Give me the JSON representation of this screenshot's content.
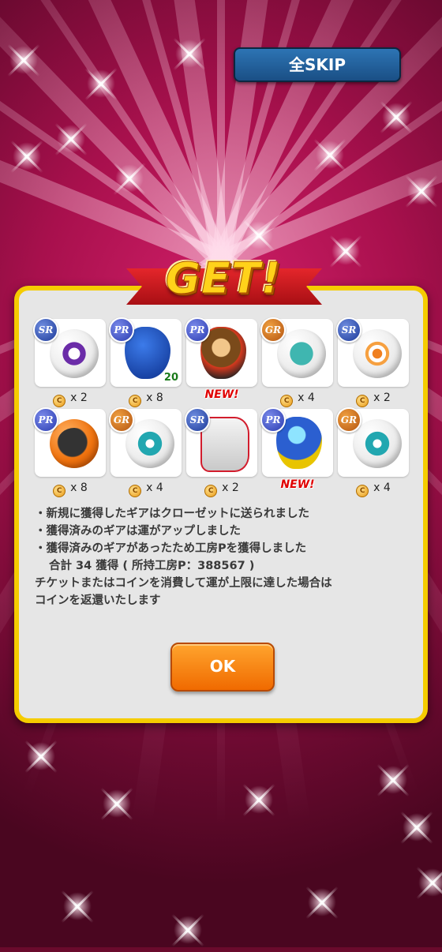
{
  "header": {
    "skip_label": "全SKIP"
  },
  "title": {
    "text": "GET!"
  },
  "rewards": [
    {
      "rarity": "SR",
      "kind": "ball",
      "icon": "purple-swirl-ball-icon",
      "count": "x 2",
      "is_new": false
    },
    {
      "rarity": "PR",
      "kind": "club",
      "icon": "blue-driver-club-icon",
      "count": "x 8",
      "is_new": false,
      "level": "20"
    },
    {
      "rarity": "PR",
      "kind": "club",
      "icon": "character-driver-club-icon",
      "count": "",
      "is_new": true
    },
    {
      "rarity": "GR",
      "kind": "ball",
      "icon": "rooster-weathervane-ball-icon",
      "count": "x 4",
      "is_new": false
    },
    {
      "rarity": "SR",
      "kind": "ball",
      "icon": "orange-target-ball-icon",
      "count": "x 2",
      "is_new": false
    },
    {
      "rarity": "PR",
      "kind": "ball",
      "icon": "black-helmet-orange-ball-icon",
      "count": "x 8",
      "is_new": false
    },
    {
      "rarity": "GR",
      "kind": "ball",
      "icon": "teal-golf-emblem-ball-icon",
      "count": "x 4",
      "is_new": false
    },
    {
      "rarity": "SR",
      "kind": "club",
      "icon": "red-wing-iron-club-icon",
      "count": "x 2",
      "is_new": false
    },
    {
      "rarity": "PR",
      "kind": "club",
      "icon": "diamond-driver-club-icon",
      "count": "",
      "is_new": true
    },
    {
      "rarity": "GR",
      "kind": "ball",
      "icon": "teal-golf-emblem-ball-icon",
      "count": "x 4",
      "is_new": false
    }
  ],
  "new_label": "NEW!",
  "coin_symbol": "C",
  "notes": [
    "・新規に獲得したギアはクローゼットに送られました",
    "・獲得済みのギアは運がアップしました",
    "・獲得済みのギアがあったため工房Pを獲得しました",
    "合計 34 獲得 ( 所持工房P：388567 )",
    "チケットまたはコインを消費して運が上限に達した場合は",
    "コインを返還いたします"
  ],
  "ok_label": "OK",
  "colors": {
    "panel_border": "#f5cc00",
    "skip_button": "#1a4f85",
    "ok_button": "#f06a00",
    "new_text": "#e00000"
  }
}
